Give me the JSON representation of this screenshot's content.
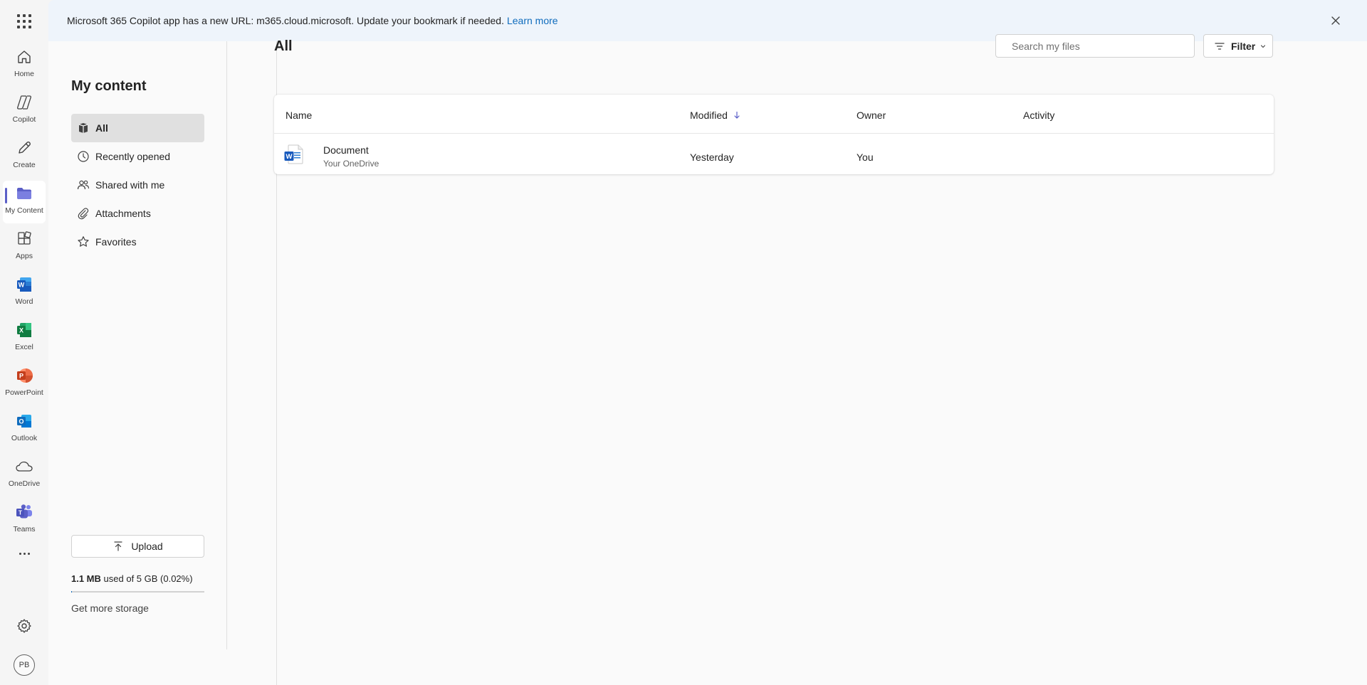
{
  "banner": {
    "message": "Microsoft 365 Copilot app has a new URL: m365.cloud.microsoft. Update your bookmark if needed.",
    "link": "Learn more"
  },
  "rail": {
    "items": [
      {
        "label": "Home",
        "icon": "home-icon"
      },
      {
        "label": "Copilot",
        "icon": "copilot-icon"
      },
      {
        "label": "Create",
        "icon": "pen-icon"
      },
      {
        "label": "My Content",
        "icon": "folder-icon"
      },
      {
        "label": "Apps",
        "icon": "apps-icon"
      },
      {
        "label": "Word",
        "icon": "word-icon"
      },
      {
        "label": "Excel",
        "icon": "excel-icon"
      },
      {
        "label": "PowerPoint",
        "icon": "powerpoint-icon"
      },
      {
        "label": "Outlook",
        "icon": "outlook-icon"
      },
      {
        "label": "OneDrive",
        "icon": "onedrive-icon"
      },
      {
        "label": "Teams",
        "icon": "teams-icon"
      }
    ],
    "avatar_initials": "PB"
  },
  "nav": {
    "title": "My content",
    "items": [
      {
        "label": "All",
        "icon": "all-files-icon"
      },
      {
        "label": "Recently opened",
        "icon": "clock-icon"
      },
      {
        "label": "Shared with me",
        "icon": "people-icon"
      },
      {
        "label": "Attachments",
        "icon": "paperclip-icon"
      },
      {
        "label": "Favorites",
        "icon": "star-icon"
      }
    ],
    "upload_label": "Upload",
    "storage_used": "1.1 MB",
    "storage_rest": "used of 5 GB (0.02%)",
    "storage_fraction": 0.0002,
    "more_storage": "Get more storage"
  },
  "main": {
    "title": "All",
    "search_placeholder": "Search my files",
    "filter_label": "Filter",
    "columns": {
      "name": "Name",
      "modified": "Modified",
      "owner": "Owner",
      "activity": "Activity"
    },
    "rows": [
      {
        "name": "Document",
        "location": "Your OneDrive",
        "modified": "Yesterday",
        "owner": "You",
        "activity": ""
      }
    ]
  },
  "colors": {
    "accent": "#5b5fc7",
    "link": "#0f6cbd",
    "word": "#185abd",
    "excel": "#107c41",
    "powerpoint": "#c43e1c",
    "outlook": "#0f6cbd",
    "teams": "#5b5fc7"
  }
}
